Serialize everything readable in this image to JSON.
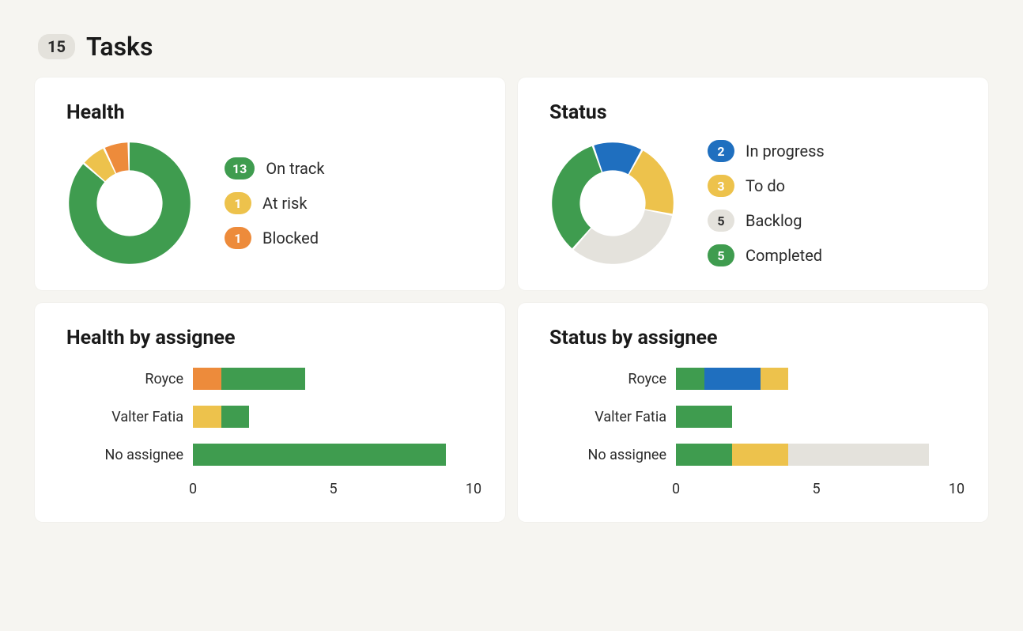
{
  "header": {
    "count": "15",
    "title": "Tasks"
  },
  "colors": {
    "green": "#3f9c4f",
    "yellow": "#edc24c",
    "orange": "#ed8b3b",
    "blue": "#1f6fbf",
    "grey": "#e4e2dc"
  },
  "cards": {
    "health": {
      "title": "Health",
      "legend": [
        {
          "count": "13",
          "label": "On track",
          "colorKey": "green"
        },
        {
          "count": "1",
          "label": "At risk",
          "colorKey": "yellow"
        },
        {
          "count": "1",
          "label": "Blocked",
          "colorKey": "orange"
        }
      ]
    },
    "status": {
      "title": "Status",
      "legend": [
        {
          "count": "2",
          "label": "In progress",
          "colorKey": "blue"
        },
        {
          "count": "3",
          "label": "To do",
          "colorKey": "yellow"
        },
        {
          "count": "5",
          "label": "Backlog",
          "colorKey": "grey"
        },
        {
          "count": "5",
          "label": "Completed",
          "colorKey": "green"
        }
      ]
    },
    "health_by_assignee": {
      "title": "Health by assignee",
      "xmax": 10,
      "ticks": [
        0,
        5,
        10
      ],
      "rows": [
        {
          "label": "Royce",
          "segments": [
            {
              "colorKey": "orange",
              "value": 1
            },
            {
              "colorKey": "green",
              "value": 3
            }
          ]
        },
        {
          "label": "Valter Fatia",
          "segments": [
            {
              "colorKey": "yellow",
              "value": 1
            },
            {
              "colorKey": "green",
              "value": 1
            }
          ]
        },
        {
          "label": "No assignee",
          "segments": [
            {
              "colorKey": "green",
              "value": 9
            }
          ]
        }
      ]
    },
    "status_by_assignee": {
      "title": "Status by assignee",
      "xmax": 10,
      "ticks": [
        0,
        5,
        10
      ],
      "rows": [
        {
          "label": "Royce",
          "segments": [
            {
              "colorKey": "green",
              "value": 1
            },
            {
              "colorKey": "blue",
              "value": 2
            },
            {
              "colorKey": "yellow",
              "value": 1
            }
          ]
        },
        {
          "label": "Valter Fatia",
          "segments": [
            {
              "colorKey": "green",
              "value": 2
            }
          ]
        },
        {
          "label": "No assignee",
          "segments": [
            {
              "colorKey": "green",
              "value": 2
            },
            {
              "colorKey": "yellow",
              "value": 2
            },
            {
              "colorKey": "grey",
              "value": 5
            }
          ]
        }
      ]
    }
  },
  "chart_data": [
    {
      "type": "pie",
      "title": "Health",
      "series": [
        {
          "name": "On track",
          "value": 13,
          "color": "#3f9c4f"
        },
        {
          "name": "At risk",
          "value": 1,
          "color": "#edc24c"
        },
        {
          "name": "Blocked",
          "value": 1,
          "color": "#ed8b3b"
        }
      ]
    },
    {
      "type": "pie",
      "title": "Status",
      "series": [
        {
          "name": "In progress",
          "value": 2,
          "color": "#1f6fbf"
        },
        {
          "name": "To do",
          "value": 3,
          "color": "#edc24c"
        },
        {
          "name": "Backlog",
          "value": 5,
          "color": "#e4e2dc"
        },
        {
          "name": "Completed",
          "value": 5,
          "color": "#3f9c4f"
        }
      ]
    },
    {
      "type": "bar",
      "title": "Health by assignee",
      "orientation": "horizontal",
      "stacked": true,
      "categories": [
        "Royce",
        "Valter Fatia",
        "No assignee"
      ],
      "series": [
        {
          "name": "On track",
          "color": "#3f9c4f",
          "values": [
            3,
            1,
            9
          ]
        },
        {
          "name": "At risk",
          "color": "#edc24c",
          "values": [
            0,
            1,
            0
          ]
        },
        {
          "name": "Blocked",
          "color": "#ed8b3b",
          "values": [
            1,
            0,
            0
          ]
        }
      ],
      "xlabel": "",
      "ylabel": "",
      "xlim": [
        0,
        10
      ],
      "xticks": [
        0,
        5,
        10
      ]
    },
    {
      "type": "bar",
      "title": "Status by assignee",
      "orientation": "horizontal",
      "stacked": true,
      "categories": [
        "Royce",
        "Valter Fatia",
        "No assignee"
      ],
      "series": [
        {
          "name": "Completed",
          "color": "#3f9c4f",
          "values": [
            1,
            2,
            2
          ]
        },
        {
          "name": "In progress",
          "color": "#1f6fbf",
          "values": [
            2,
            0,
            0
          ]
        },
        {
          "name": "To do",
          "color": "#edc24c",
          "values": [
            1,
            0,
            2
          ]
        },
        {
          "name": "Backlog",
          "color": "#e4e2dc",
          "values": [
            0,
            0,
            5
          ]
        }
      ],
      "xlabel": "",
      "ylabel": "",
      "xlim": [
        0,
        10
      ],
      "xticks": [
        0,
        5,
        10
      ]
    }
  ]
}
